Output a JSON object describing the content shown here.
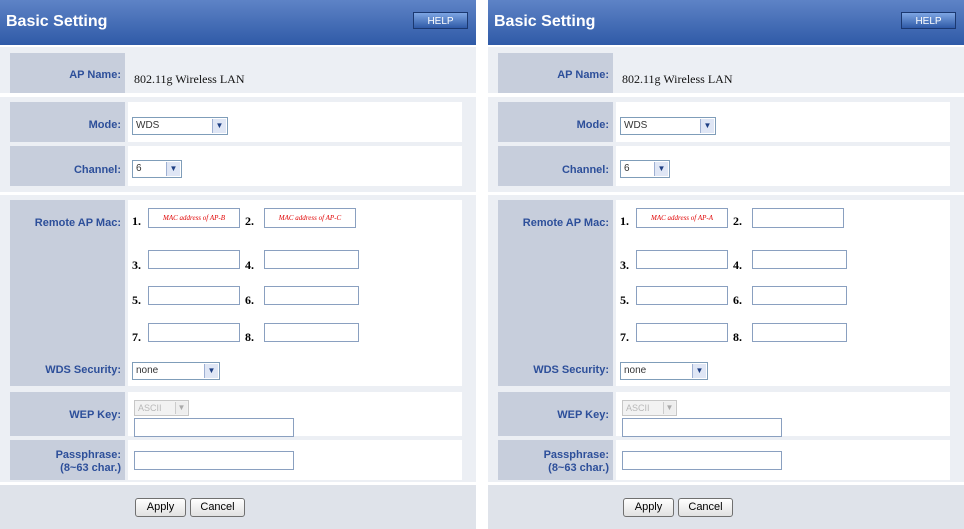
{
  "panels": [
    {
      "title": "Basic Setting",
      "help_label": "HELP",
      "ap_name_label": "AP Name:",
      "ap_name_value": "802.11g Wireless LAN",
      "mode_label": "Mode:",
      "mode_value": "WDS",
      "channel_label": "Channel:",
      "channel_value": "6",
      "remote_ap_mac_label": "Remote AP Mac:",
      "mac_numbers": [
        "1.",
        "2.",
        "3.",
        "4.",
        "5.",
        "6.",
        "7.",
        "8."
      ],
      "mac_values": [
        "MAC address of AP-B",
        "MAC address of AP-C",
        "",
        "",
        "",
        "",
        "",
        ""
      ],
      "wds_security_label": "WDS Security:",
      "wds_security_value": "none",
      "wep_key_label": "WEP Key:",
      "wep_key_format": "ASCII",
      "wep_key_value": "",
      "passphrase_label_line1": "Passphrase:",
      "passphrase_label_line2": "(8~63 char.)",
      "passphrase_value": "",
      "apply_label": "Apply",
      "cancel_label": "Cancel"
    },
    {
      "title": "Basic Setting",
      "help_label": "HELP",
      "ap_name_label": "AP Name:",
      "ap_name_value": "802.11g Wireless LAN",
      "mode_label": "Mode:",
      "mode_value": "WDS",
      "channel_label": "Channel:",
      "channel_value": "6",
      "remote_ap_mac_label": "Remote AP Mac:",
      "mac_numbers": [
        "1.",
        "2.",
        "3.",
        "4.",
        "5.",
        "6.",
        "7.",
        "8."
      ],
      "mac_values": [
        "MAC address of AP-A",
        "",
        "",
        "",
        "",
        "",
        "",
        ""
      ],
      "wds_security_label": "WDS Security:",
      "wds_security_value": "none",
      "wep_key_label": "WEP Key:",
      "wep_key_format": "ASCII",
      "wep_key_value": "",
      "passphrase_label_line1": "Passphrase:",
      "passphrase_label_line2": "(8~63 char.)",
      "passphrase_value": "",
      "apply_label": "Apply",
      "cancel_label": "Cancel"
    }
  ],
  "colors": {
    "header_blue": "#2f5aa7",
    "label_blue": "#2d4f9a",
    "label_cell": "#c7cedc",
    "mac_text_red": "#e00000"
  },
  "icons": {
    "dropdown": "chevron-down-icon"
  }
}
